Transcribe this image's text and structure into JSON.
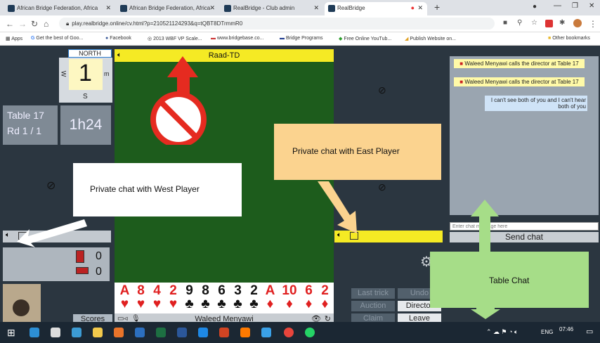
{
  "browser": {
    "tabs": [
      {
        "title": "African Bridge Federation, Africa"
      },
      {
        "title": "African Bridge Federation, Africa"
      },
      {
        "title": "RealBridge - Club admin"
      },
      {
        "title": "RealBridge",
        "active": true
      }
    ],
    "url": "play.realbridge.online/cv.html?p=210521124293&q=tQBT8DTrmmR0",
    "bookmarks": [
      "Apps",
      "Get the best of Goo...",
      "Facebook",
      "2013 WBF VP Scale...",
      "www.bridgebase.co...",
      "Bridge Programs",
      "Free Online YouTub...",
      "Publish Website on..."
    ],
    "other_bookmarks": "Other bookmarks"
  },
  "table": {
    "north_label": "NORTH",
    "board_number": "1",
    "compass_w": "W",
    "compass_s": "S",
    "compass_e": "m",
    "table_label": "Table 17",
    "round_label": "Rd 1 / 1",
    "time": "1h24",
    "top_player": "Raad-TD",
    "bottom_player": "Waleed Menyawi",
    "scores_btn": "Scores",
    "score_top": "0",
    "score_bottom": "0"
  },
  "hand": [
    {
      "rank": "A",
      "suit": "♥",
      "color": "#e02020"
    },
    {
      "rank": "8",
      "suit": "♥",
      "color": "#e02020"
    },
    {
      "rank": "4",
      "suit": "♥",
      "color": "#e02020"
    },
    {
      "rank": "2",
      "suit": "♥",
      "color": "#e02020"
    },
    {
      "rank": "9",
      "suit": "♣",
      "color": "#111111"
    },
    {
      "rank": "8",
      "suit": "♣",
      "color": "#111111"
    },
    {
      "rank": "6",
      "suit": "♣",
      "color": "#111111"
    },
    {
      "rank": "3",
      "suit": "♣",
      "color": "#111111"
    },
    {
      "rank": "2",
      "suit": "♣",
      "color": "#111111"
    },
    {
      "rank": "A",
      "suit": "♦",
      "color": "#e02020"
    },
    {
      "rank": "10",
      "suit": "♦",
      "color": "#e02020"
    },
    {
      "rank": "6",
      "suit": "♦",
      "color": "#e02020"
    },
    {
      "rank": "2",
      "suit": "♦",
      "color": "#e02020"
    }
  ],
  "chat": {
    "messages": [
      {
        "text": "Waleed Menyawi calls the director at Table 17",
        "style": "y"
      },
      {
        "text": "Waleed Menyawi calls the director at Table 17",
        "style": "y"
      },
      {
        "text": "I can't see both of you and I can't hear both of you",
        "style": "b"
      }
    ],
    "input_placeholder": "Enter chat message here",
    "send_label": "Send chat"
  },
  "buttons": {
    "last_trick": "Last trick",
    "undo": "Undo",
    "auction": "Auction",
    "director": "Director",
    "claim": "Claim",
    "leave": "Leave"
  },
  "callouts": {
    "west": "Private chat with West Player",
    "east": "Private chat with East Player",
    "table": "Table Chat"
  },
  "taskbar": {
    "lang": "ENG",
    "time": "07:46"
  },
  "colors": {
    "felt": "#1d5c1c",
    "active_bar": "#f5ea24",
    "panel_dark": "#2b3640",
    "callout_orange": "#fbd38f",
    "callout_green": "#a6dd88"
  }
}
